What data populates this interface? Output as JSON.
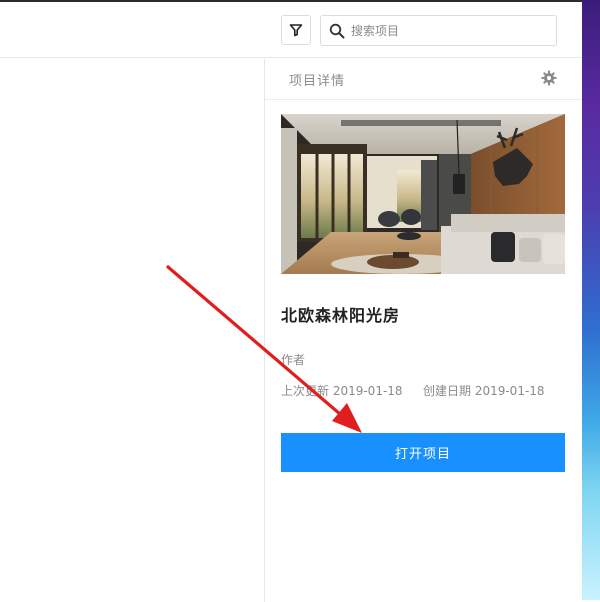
{
  "toolbar": {
    "filter_icon": "filter-icon",
    "search_icon": "search-icon",
    "search_placeholder": "搜索项目",
    "search_value": ""
  },
  "panel": {
    "title": "项目详情",
    "settings_icon": "gear-icon",
    "project_name": "北欧森林阳光房",
    "author_label": "作者",
    "updated_text": "上次更新 2019-01-18",
    "created_text": "创建日期 2019-01-18",
    "open_button_label": "打开项目"
  },
  "colors": {
    "accent": "#1890ff",
    "annotation_arrow": "#e01e1e"
  }
}
